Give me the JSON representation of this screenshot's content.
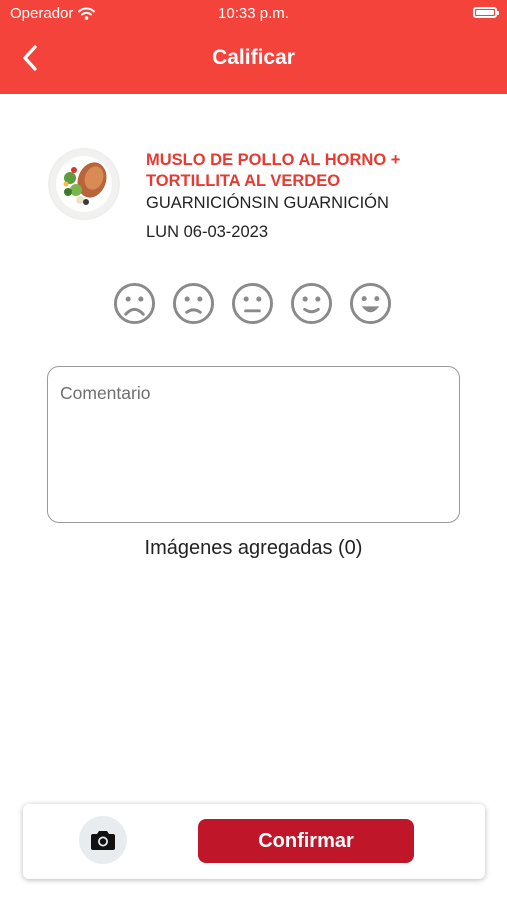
{
  "status_bar": {
    "carrier": "Operador",
    "time": "10:33 p.m."
  },
  "header": {
    "title": "Calificar",
    "back_icon": "chevron-left-icon",
    "background_color": "#f4433b"
  },
  "dish": {
    "image_icon": "food-plate-image",
    "name": "MUSLO DE POLLO AL HORNO + TORTILLITA AL VERDEO",
    "garnish": "GUARNICIÓNSIN GUARNICIÓN",
    "date": "LUN 06-03-2023",
    "name_color": "#e63a32"
  },
  "rating": {
    "options": [
      "very-sad-face-icon",
      "sad-face-icon",
      "neutral-face-icon",
      "slight-smile-face-icon",
      "happy-face-icon"
    ],
    "selected": null,
    "icon_color": "#8a8a8a"
  },
  "comment": {
    "placeholder": "Comentario",
    "value": ""
  },
  "images": {
    "label": "Imágenes agregadas (0)"
  },
  "footer": {
    "camera_icon": "camera-icon",
    "confirm_label": "Confirmar",
    "confirm_color": "#c0162a"
  }
}
